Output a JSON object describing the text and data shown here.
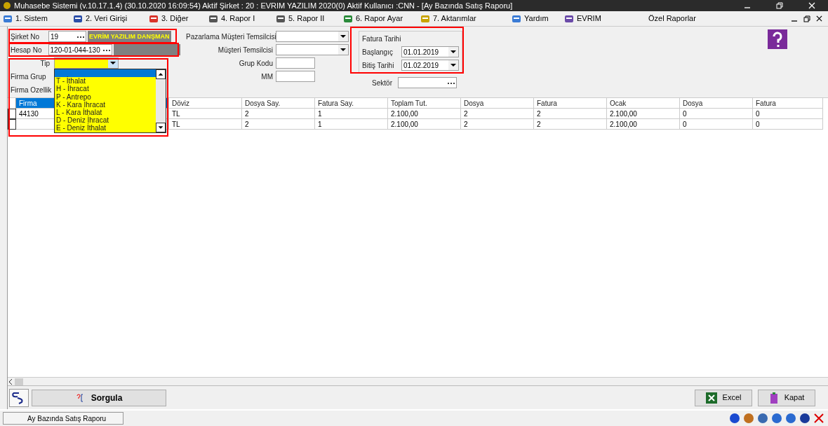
{
  "window": {
    "title": "Muhasebe Sistemi (v.10.17.1.4) (30.10.2020 16:09:54) Aktif Şirket : 20 : EVRIM YAZILIM  2020(0) Aktif Kullanıcı :CNN - [Ay Bazında Satış Raporu]"
  },
  "menu": [
    "1.  Sistem",
    "2. Veri Girişi",
    "3.  Diğer",
    "4.  Rapor I",
    "5.  Rapor II",
    "6.  Rapor Ayar",
    "7.  Aktarımlar",
    "Yardım",
    "EVRIM",
    "Özel Raporlar"
  ],
  "form": {
    "sirket_no": {
      "label": "Şirket No",
      "value": "19",
      "name": "EVRİM YAZILIM DANŞMAN"
    },
    "hesap_no": {
      "label": "Hesap No",
      "value": "120-01-044-130"
    },
    "tip": {
      "label": "Tip",
      "expanded": true,
      "options": [
        {
          "selected": true
        },
        {
          "label": "T - İthalat",
          "selected": false
        },
        {
          "label": "H - İhracat",
          "selected": false
        },
        {
          "label": "P - Antrepo",
          "selected": false
        },
        {
          "label": "K - Kara İhracat",
          "selected": false
        },
        {
          "label": "L - Kara İthalat",
          "selected": false
        },
        {
          "label": "D - Deniz İhracat",
          "selected": false
        },
        {
          "label": "E - Deniz İthalat",
          "selected": false
        }
      ]
    },
    "firma_grup": {
      "label": "Firma Grup"
    },
    "firma_ozellik": {
      "label": "Firma Ozellik"
    },
    "pazarlama": {
      "label": "Pazarlama Müşteri Temsilcisi"
    },
    "musteri": {
      "label": "Müşteri Temsilcisi"
    },
    "grup_kodu": {
      "label": "Grup Kodu"
    },
    "mm": {
      "label": "MM"
    },
    "fatura_tarihi": {
      "title": "Fatura Tarihi",
      "baslangic": {
        "label": "Başlangıç",
        "value": "01.01.2019"
      },
      "bitis": {
        "label": "Bitiş Tarihi",
        "value": "01.02.2019"
      }
    },
    "sektor": {
      "label": "Sektör"
    }
  },
  "table": {
    "columns": [
      {
        "label": "Firma",
        "selected": true
      },
      {
        "label": "Döviz",
        "selected": false
      },
      {
        "label": "Dosya Say.",
        "selected": false
      },
      {
        "label": "Fatura Say.",
        "selected": false
      },
      {
        "label": "Toplam Tut.",
        "selected": false
      },
      {
        "label": "Dosya",
        "selected": false
      },
      {
        "label": "Fatura",
        "selected": false
      },
      {
        "label": "Ocak",
        "selected": false
      },
      {
        "label": "Dosya",
        "selected": false
      },
      {
        "label": "Fatura",
        "selected": false
      }
    ],
    "rows": [
      [
        "44130",
        "TL",
        "2",
        "1",
        "2.100,00",
        "2",
        "2",
        "2.100,00",
        "0",
        "0"
      ],
      [
        "",
        "TL",
        "2",
        "1",
        "2.100,00",
        "2",
        "2",
        "2.100,00",
        "0",
        "0"
      ]
    ]
  },
  "buttons": {
    "sorgula": "Sorgula",
    "excel": "Excel",
    "kapat": "Kapat"
  },
  "taskbar": {
    "item": "Ay Bazında Satış Raporu"
  }
}
